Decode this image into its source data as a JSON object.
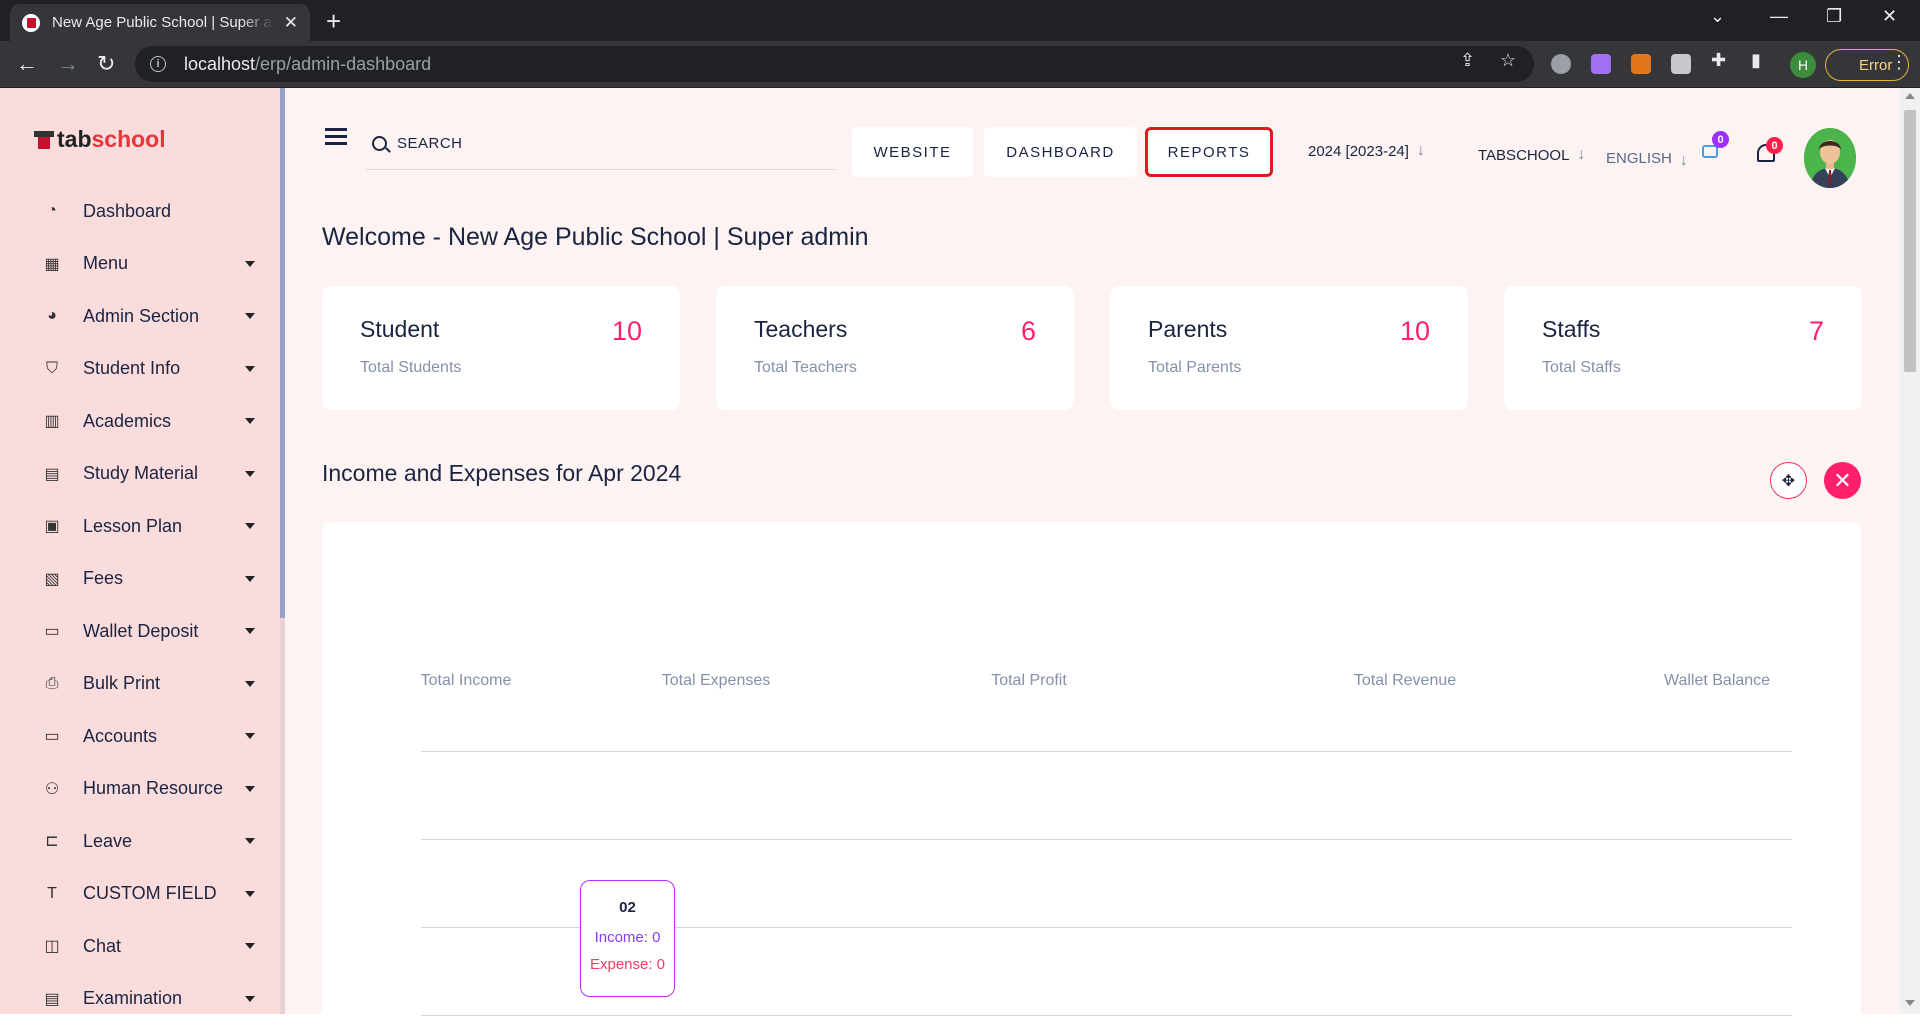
{
  "browser": {
    "tab_title": "New Age Public School | Super admin",
    "url_host": "localhost",
    "url_path": "/erp/admin-dashboard",
    "profile_initial": "H",
    "error_label": "Error"
  },
  "brand": {
    "logo_part1": "tab",
    "logo_part2": "school"
  },
  "sidebar": {
    "items": [
      {
        "label": "Dashboard",
        "icon": "gauge-icon",
        "glyph": "◔"
      },
      {
        "label": "Menu",
        "icon": "grid-icon",
        "glyph": "▦"
      },
      {
        "label": "Admin Section",
        "icon": "pie-chart-icon",
        "glyph": "◕"
      },
      {
        "label": "Student Info",
        "icon": "graduation-cap-icon",
        "glyph": "⛉"
      },
      {
        "label": "Academics",
        "icon": "book-icon",
        "glyph": "▥"
      },
      {
        "label": "Study Material",
        "icon": "document-icon",
        "glyph": "▤"
      },
      {
        "label": "Lesson Plan",
        "icon": "calendar-edit-icon",
        "glyph": "▣"
      },
      {
        "label": "Fees",
        "icon": "receipt-icon",
        "glyph": "▧"
      },
      {
        "label": "Wallet Deposit",
        "icon": "wallet-icon",
        "glyph": "▭"
      },
      {
        "label": "Bulk Print",
        "icon": "printer-icon",
        "glyph": "⎙"
      },
      {
        "label": "Accounts",
        "icon": "card-icon",
        "glyph": "▭"
      },
      {
        "label": "Human Resource",
        "icon": "users-icon",
        "glyph": "⚇"
      },
      {
        "label": "Leave",
        "icon": "bed-icon",
        "glyph": "⊏"
      },
      {
        "label": "CUSTOM FIELD",
        "icon": "text-box-icon",
        "glyph": "T"
      },
      {
        "label": "Chat",
        "icon": "chat-icon",
        "glyph": "◫"
      },
      {
        "label": "Examination",
        "icon": "exam-icon",
        "glyph": "▤"
      }
    ]
  },
  "header": {
    "search_label": "SEARCH",
    "website_label": "WEBSITE",
    "dashboard_label": "DASHBOARD",
    "reports_label": "REPORTS",
    "session_label": "2024 [2023-24]",
    "school_label": "TABSCHOOL",
    "language_label": "ENGLISH",
    "message_count": "0",
    "notification_count": "0"
  },
  "welcome": "Welcome - New Age Public School | Super admin",
  "stats": [
    {
      "title": "Student",
      "subtitle": "Total Students",
      "value": "10"
    },
    {
      "title": "Teachers",
      "subtitle": "Total Teachers",
      "value": "6"
    },
    {
      "title": "Parents",
      "subtitle": "Total Parents",
      "value": "10"
    },
    {
      "title": "Staffs",
      "subtitle": "Total Staffs",
      "value": "7"
    }
  ],
  "income_section": {
    "title": "Income and Expenses for Apr 2024"
  },
  "colors": {
    "accent_pink": "#ff1f6a",
    "income_purple": "#8a3cf0",
    "expense_red": "#f03c64",
    "highlight_red": "#e01b1b"
  },
  "chart_data": {
    "type": "line",
    "legend": [
      "Total Income",
      "Total Expenses",
      "Total Profit",
      "Total Revenue",
      "Wallet Balance"
    ],
    "tooltip": {
      "category": "02",
      "income": "Income: 0",
      "expense": "Expense: 0"
    },
    "series": [
      {
        "name": "Total Income",
        "values": [
          0
        ]
      },
      {
        "name": "Total Expenses",
        "values": [
          0
        ]
      }
    ],
    "categories": [
      "02"
    ],
    "grid": true
  }
}
